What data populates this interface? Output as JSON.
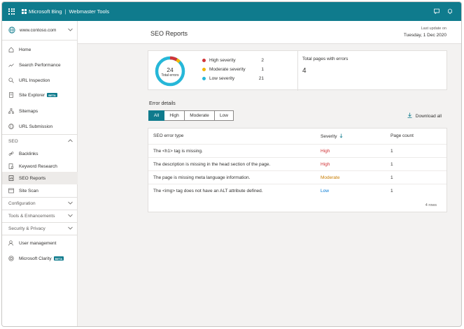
{
  "topbar": {
    "brand": "Microsoft Bing",
    "product": "Webmaster Tools"
  },
  "site": {
    "name": "www.contoso.com"
  },
  "nav": {
    "home": "Home",
    "search_performance": "Search Performance",
    "url_inspection": "URL Inspection",
    "site_explorer": "Site Explorer",
    "sitemaps": "Sitemaps",
    "url_submission": "URL Submission",
    "seo_section": "SEO",
    "backlinks": "Backlinks",
    "keyword_research": "Keyword Research",
    "seo_reports": "SEO Reports",
    "site_scan": "Site Scan",
    "configuration": "Configuration",
    "tools": "Tools & Enhancements",
    "security": "Security & Privacy",
    "user_management": "User management",
    "clarity": "Microsoft Clarity",
    "beta": "BETA"
  },
  "header": {
    "title": "SEO Reports",
    "last_update_label": "Last update on",
    "last_update_value": "Tuesday, 1 Dec 2020"
  },
  "summary": {
    "total_errors": "24",
    "total_errors_label": "Total errors",
    "legend": [
      {
        "label": "High severity",
        "value": "2",
        "color": "#d13438"
      },
      {
        "label": "Moderate severity",
        "value": "1",
        "color": "#f2b600"
      },
      {
        "label": "Low severity",
        "value": "21",
        "color": "#26b7d8"
      }
    ],
    "pages_label": "Total pages with errors",
    "pages_value": "4"
  },
  "details": {
    "title": "Error details",
    "tabs": [
      "All",
      "High",
      "Moderate",
      "Low"
    ],
    "download": "Download all",
    "columns": {
      "type": "SEO error type",
      "severity": "Severity",
      "count": "Page count"
    },
    "rows": [
      {
        "type": "The <h1> tag is missing.",
        "severity": "High",
        "count": "1"
      },
      {
        "type": "The description is missing in the head section of the page.",
        "severity": "High",
        "count": "1"
      },
      {
        "type": "The page is missing meta language information.",
        "severity": "Moderate",
        "count": "1"
      },
      {
        "type": "The <img> tag does not have an ALT attribute defined.",
        "severity": "Low",
        "count": "1"
      }
    ],
    "row_count": "4 rows"
  },
  "colors": {
    "accent": "#0f7b8d",
    "high": "#d13438",
    "moderate": "#c87c00",
    "low": "#0078d4"
  }
}
